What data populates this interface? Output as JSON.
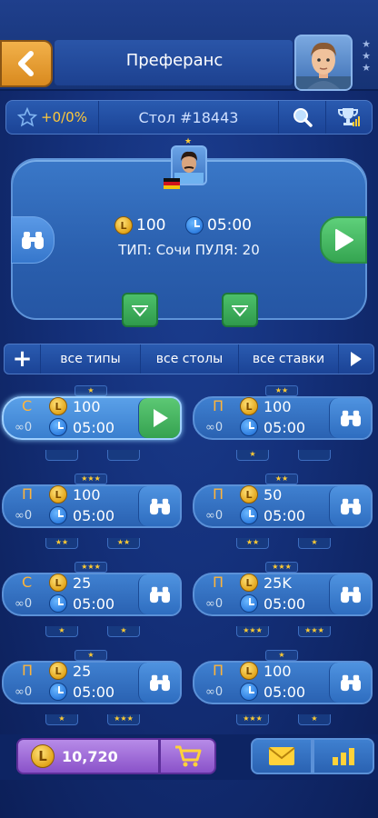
{
  "header": {
    "title": "Преферанс",
    "back_icon": "chevron-left-icon",
    "avatar_stars": "★\n★\n★"
  },
  "infobar": {
    "rating": "+0/0%",
    "table": "Стол #18443",
    "search_icon": "magnifier-icon",
    "leaderboard_icon": "trophy-icon"
  },
  "panel": {
    "star": "★",
    "stake": "100",
    "time": "05:00",
    "type_line": "ТИП: Сочи ПУЛЯ: 20",
    "left_icon": "binoculars-icon",
    "right_icon": "play-icon"
  },
  "filters": {
    "add": "+",
    "types": "все типы",
    "tables": "все столы",
    "stakes": "все ставки"
  },
  "tables": [
    {
      "type": "С",
      "stake": "100",
      "time": "05:00",
      "players": "0",
      "top_stars": "★",
      "bottom_left": "",
      "bottom_right": "",
      "active": true
    },
    {
      "type": "П",
      "stake": "100",
      "time": "05:00",
      "players": "0",
      "top_stars": "★★",
      "bottom_left": "★",
      "bottom_right": "",
      "active": false
    },
    {
      "type": "П",
      "stake": "100",
      "time": "05:00",
      "players": "0",
      "top_stars": "★★★",
      "bottom_left": "★★",
      "bottom_right": "★★",
      "active": false
    },
    {
      "type": "П",
      "stake": "50",
      "time": "05:00",
      "players": "0",
      "top_stars": "★★",
      "bottom_left": "★★",
      "bottom_right": "★",
      "active": false
    },
    {
      "type": "С",
      "stake": "25",
      "time": "05:00",
      "players": "0",
      "top_stars": "★★★",
      "bottom_left": "★",
      "bottom_right": "★",
      "active": false
    },
    {
      "type": "П",
      "stake": "25K",
      "time": "05:00",
      "players": "0",
      "top_stars": "★★★",
      "bottom_left": "★★★",
      "bottom_right": "★★★",
      "active": false
    },
    {
      "type": "П",
      "stake": "25",
      "time": "05:00",
      "players": "0",
      "top_stars": "★",
      "bottom_left": "★",
      "bottom_right": "★★★",
      "active": false
    },
    {
      "type": "П",
      "stake": "100",
      "time": "05:00",
      "players": "0",
      "top_stars": "★",
      "bottom_left": "★★★",
      "bottom_right": "★",
      "active": false
    }
  ],
  "bottom": {
    "balance": "10,720",
    "currency_icon": "coin-icon",
    "cart_icon": "cart-icon",
    "mail_icon": "mail-icon",
    "stats_icon": "bar-chart-icon"
  },
  "colors": {
    "accent_orange": "#e9a032",
    "play_green": "#3fb35a",
    "balance_purple": "#9b66d8",
    "panel_blue": "#2f68b8"
  }
}
